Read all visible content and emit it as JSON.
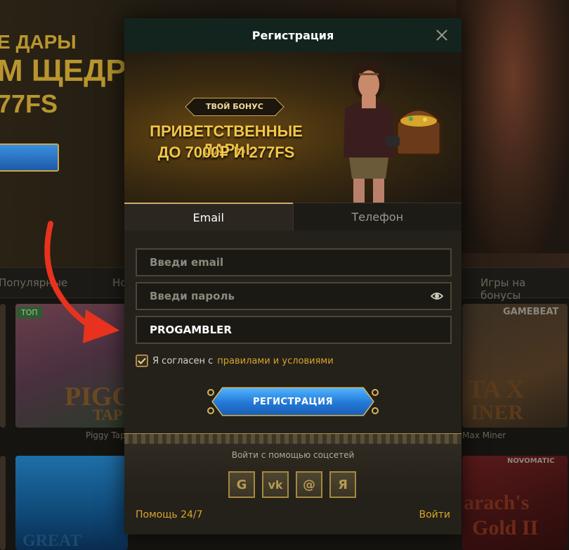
{
  "background": {
    "hero_lines": [
      "Е ДАРЫ",
      "М ЩЕДРО",
      "77FS"
    ],
    "tabs": [
      "Популярные",
      "Но",
      "Игры на бонусы"
    ],
    "badge_top": "ТОП",
    "tiles": {
      "piggy_label": "Piggy Tap",
      "piggy_art": "PIGG",
      "piggy_art2": "TAP",
      "max_label": "Max Miner",
      "max_art": "TA X",
      "max_art2": "INER",
      "whale_art": "GREAT BLUE",
      "pharaoh_art": "arach's",
      "pharaoh_art2": "Gold II"
    },
    "gamebeat": "GAMEBEAT",
    "novomatic": "NOVOMATIC"
  },
  "modal": {
    "title": "Регистрация",
    "banner": {
      "badge": "ТВОЙ БОНУС",
      "line1": "ПРИВЕТСТВЕННЫЕ ДАРЫ",
      "line2": "ДО 7000₽ И 277FS"
    },
    "tabs": [
      {
        "label": "Email",
        "active": true
      },
      {
        "label": "Телефон",
        "active": false
      }
    ],
    "form": {
      "email_placeholder": "Введи email",
      "password_placeholder": "Введи пароль",
      "promo_value": "PROGAMBLER",
      "agree_checked": true,
      "agree_text": "Я согласен с",
      "agree_link": "правилами и условиями",
      "submit_label": "РЕГИСТРАЦИЯ"
    },
    "social": {
      "title": "Войти с помощью соцсетей",
      "buttons": [
        "G",
        "vk",
        "@",
        "Я"
      ]
    },
    "footer": {
      "help": "Помощь 24/7",
      "login": "Войти"
    }
  },
  "colors": {
    "accent_gold": "#d6a52a",
    "header_bg": "#13241e",
    "button_blue": "#2378d6",
    "arrow_red": "#e8321e"
  }
}
